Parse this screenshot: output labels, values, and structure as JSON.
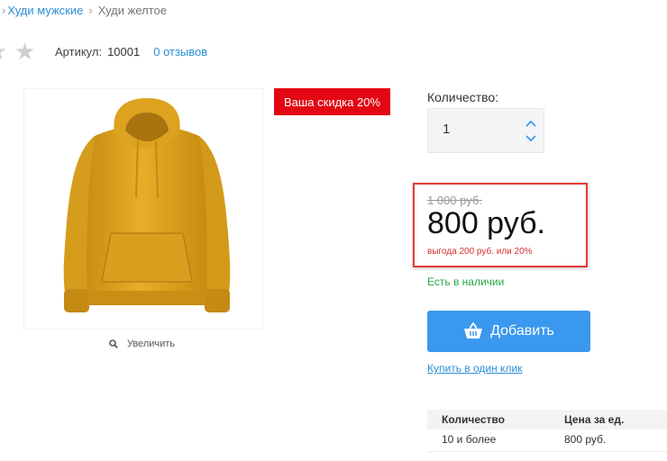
{
  "breadcrumb": {
    "items": [
      {
        "label": "Худи мужские",
        "link": true
      },
      {
        "label": "Худи желтое",
        "link": false
      }
    ]
  },
  "product": {
    "sku_label": "Артикул:",
    "sku_value": "10001",
    "reviews": "0 отзывов",
    "discount_badge": "Ваша скидка 20%",
    "zoom_label": "Увеличить"
  },
  "purchase": {
    "quantity_label": "Количество:",
    "quantity_value": "1",
    "old_price": "1 000 руб.",
    "new_price": "800 руб.",
    "savings": "выгода 200 руб. или 20%",
    "stock": "Есть в наличии",
    "add_button": "Добавить",
    "one_click": "Купить в один клик"
  },
  "price_table": {
    "headers": [
      "Количество",
      "Цена за ед."
    ],
    "rows": [
      [
        "10 и более",
        "800 руб."
      ]
    ]
  },
  "colors": {
    "accent": "#3a98ee",
    "link": "#2b8fd6",
    "badge": "#e30613",
    "stock": "#27a745",
    "highlight_border": "#e53935",
    "product": "#e2a724"
  }
}
